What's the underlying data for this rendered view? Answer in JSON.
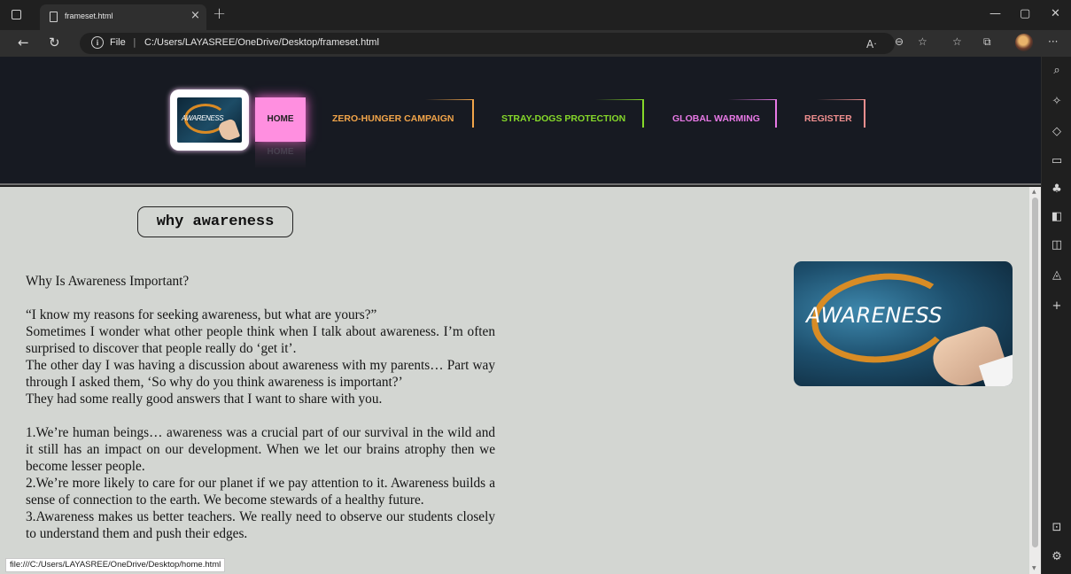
{
  "browser": {
    "tab_title": "frameset.html",
    "tab_close": "×",
    "new_tab": "+",
    "address_scheme": "File",
    "address_separator": "|",
    "address_path": "C:/Users/LAYASREE/OneDrive/Desktop/frameset.html",
    "status_url": "file:///C:/Users/LAYASREE/OneDrive/Desktop/home.html"
  },
  "header": {
    "logo_text": "AWARENESS",
    "nav": [
      {
        "label": "HOME",
        "color": "#222222"
      },
      {
        "label": "ZERO-HUNGER CAMPAIGN",
        "color": "#f2a54a"
      },
      {
        "label": "STRAY-DOGS PROTECTION",
        "color": "#86d92a"
      },
      {
        "label": "GLOBAL WARMING",
        "color": "#e879e6"
      },
      {
        "label": "REGISTER",
        "color": "#f08f8f"
      }
    ],
    "home_reflection": "HOME",
    "home_bg": "#ff8fe0"
  },
  "content": {
    "title": "why awareness",
    "image_text": "AWARENESS",
    "paragraphs": [
      "Why Is Awareness Important?",
      "",
      "“I know my reasons for seeking awareness, but what are yours?”",
      "Sometimes I wonder what other people think when I talk about awareness. I’m often surprised to discover that people really do ‘get it’.",
      "The other day I was having a discussion about awareness with my parents… Part way through I asked them, ‘So why do you think awareness is important?’",
      "They had some really good answers that I want to share with you.",
      "",
      "1.We’re human beings… awareness was a crucial part of our survival in the wild and it still has an impact on our development. When we let our brains atrophy then we become lesser people.",
      "2.We’re more likely to care for our planet if we pay attention to it. Awareness builds a sense of connection to the earth. We become stewards of a healthy future.",
      "3.Awareness makes us better teachers. We really need to observe our students closely to understand them and push their edges."
    ]
  },
  "colors": {
    "header_bg": "#171a22",
    "content_bg": "#d3d6d2"
  }
}
